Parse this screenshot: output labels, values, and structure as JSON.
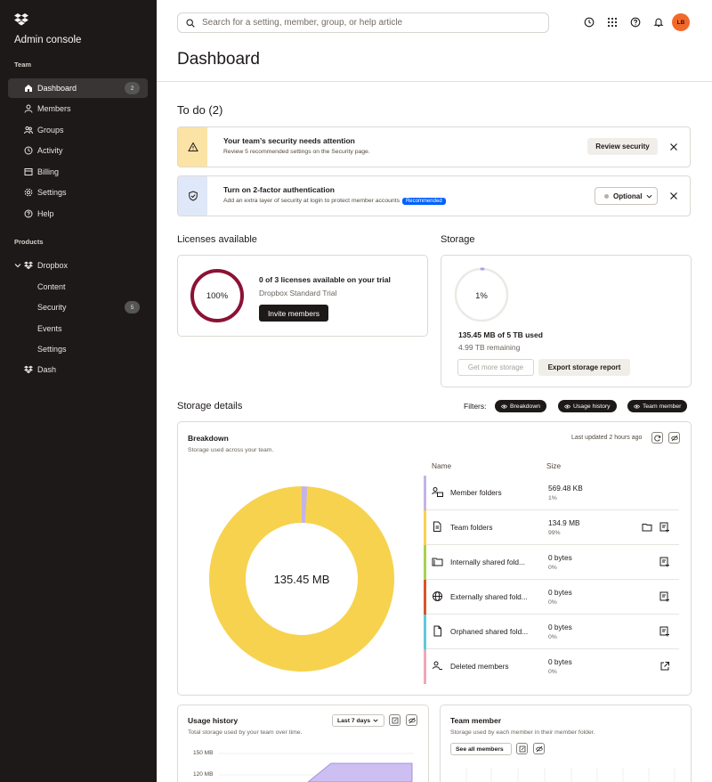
{
  "app": {
    "title": "Admin console"
  },
  "sidebar": {
    "team_label": "Team",
    "team_items": [
      {
        "label": "Dashboard",
        "icon": "home-icon",
        "badge": "2"
      },
      {
        "label": "Members",
        "icon": "person-icon"
      },
      {
        "label": "Groups",
        "icon": "group-icon"
      },
      {
        "label": "Activity",
        "icon": "clock-icon"
      },
      {
        "label": "Billing",
        "icon": "billing-icon"
      },
      {
        "label": "Settings",
        "icon": "gear-icon"
      },
      {
        "label": "Help",
        "icon": "help-icon"
      }
    ],
    "products_label": "Products",
    "dropbox": {
      "label": "Dropbox",
      "icon": "dropbox-icon"
    },
    "dropbox_items": [
      {
        "label": "Content"
      },
      {
        "label": "Security",
        "badge": "5"
      },
      {
        "label": "Events"
      },
      {
        "label": "Settings"
      }
    ],
    "dash": {
      "label": "Dash",
      "icon": "dropbox-icon"
    }
  },
  "search": {
    "placeholder": "Search for a setting, member, group, or help article"
  },
  "avatar": {
    "initials": "LB",
    "color": "#f3692a"
  },
  "page": {
    "title": "Dashboard"
  },
  "todo": {
    "title": "To do (2)",
    "alerts": [
      {
        "title": "Your team’s security needs attention",
        "desc": "Review 5 recommended settings on the Security page.",
        "action": "Review security",
        "strip_color": "#fbe3a6"
      },
      {
        "title": "Turn on 2-factor authentication",
        "desc": "Add an extra layer of security at login to protect member accounts",
        "badge": "Recommended",
        "select_value": "Optional",
        "strip_color": "#dfe8f8"
      }
    ]
  },
  "licenses": {
    "title": "Licenses available",
    "percent": "100%",
    "percent_value": 100,
    "headline": "0 of 3 licenses available on your trial",
    "plan": "Dropbox Standard Trial",
    "button": "Invite members",
    "ring_color": "#8c1235"
  },
  "storage": {
    "title": "Storage",
    "percent": "1%",
    "percent_value": 1,
    "used": "135.45 MB of 5 TB used",
    "remaining": "4.99 TB remaining",
    "get_more": "Get more storage",
    "export": "Export storage report"
  },
  "storage_details": {
    "title": "Storage details",
    "filters_label": "Filters:",
    "filters": [
      "Breakdown",
      "Usage history",
      "Team member"
    ]
  },
  "breakdown": {
    "title": "Breakdown",
    "subtitle": "Storage used across your team.",
    "updated": "Last updated 2 hours ago",
    "center_label": "135.45 MB",
    "col_name": "Name",
    "col_size": "Size",
    "rows": [
      {
        "name": "Member folders",
        "size": "569.48 KB",
        "pct": "1%",
        "color": "#c5b3e6",
        "icon": "member-folders-icon"
      },
      {
        "name": "Team folders",
        "size": "134.9 MB",
        "pct": "99%",
        "color": "#f7d24e",
        "icon": "team-folders-icon"
      },
      {
        "name": "Internally shared fold...",
        "size": "0 bytes",
        "pct": "0%",
        "color": "#a6d24e",
        "icon": "shared-folder-icon"
      },
      {
        "name": "Externally shared fold...",
        "size": "0 bytes",
        "pct": "0%",
        "color": "#d9532c",
        "icon": "globe-icon"
      },
      {
        "name": "Orphaned shared fold...",
        "size": "0 bytes",
        "pct": "0%",
        "color": "#5fc9d6",
        "icon": "orphan-file-icon"
      },
      {
        "name": "Deleted members",
        "size": "0 bytes",
        "pct": "0%",
        "color": "#f0a8b4",
        "icon": "deleted-member-icon"
      }
    ]
  },
  "usage_history": {
    "title": "Usage history",
    "subtitle": "Total storage used by your team over time.",
    "range": "Last 7 days",
    "y_ticks": [
      "150 MB",
      "120 MB"
    ]
  },
  "team_member": {
    "title": "Team member",
    "subtitle": "Storage used by each member in their member folder.",
    "button": "See all members"
  },
  "chart_data": {
    "type": "pie",
    "title": "Breakdown",
    "center_label": "135.45 MB",
    "categories": [
      "Member folders",
      "Team folders",
      "Internally shared folders",
      "Externally shared folders",
      "Orphaned shared folders",
      "Deleted members"
    ],
    "values": [
      1,
      99,
      0,
      0,
      0,
      0
    ],
    "colors": [
      "#c5b3e6",
      "#f7d24e",
      "#a6d24e",
      "#d9532c",
      "#5fc9d6",
      "#f0a8b4"
    ]
  }
}
